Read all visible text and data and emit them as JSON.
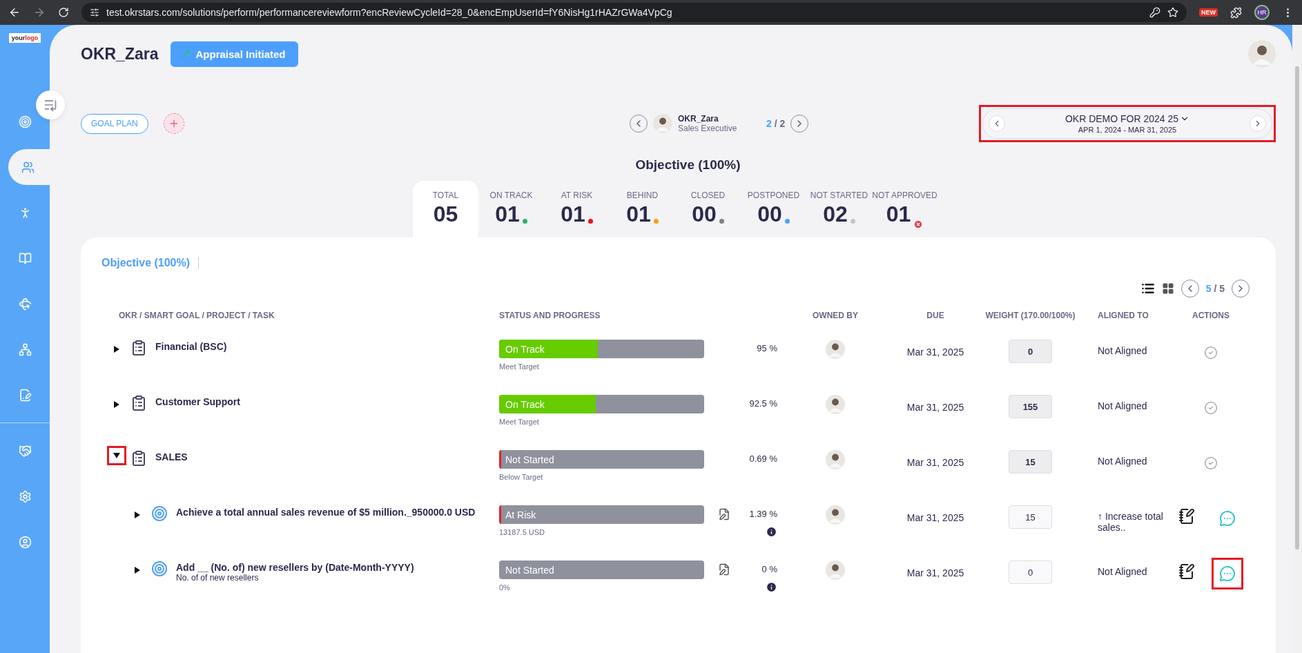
{
  "browser": {
    "url": "test.okrstars.com/solutions/perform/performancereviewform?encReviewCycleId=28_0&encEmpUserId=fY6NisHg1rHAZrGWa4VpCg",
    "badge": "NEW",
    "profile": "HR"
  },
  "logo": {
    "text": "your",
    "accent": "logo"
  },
  "sidebar": {
    "groups": [
      [
        {
          "selected": false
        },
        {
          "selected": true
        },
        {
          "selected": false
        },
        {
          "selected": false
        },
        {
          "selected": false
        },
        {
          "selected": false
        },
        {
          "selected": false
        }
      ],
      [
        {
          "selected": false
        },
        {
          "selected": false
        },
        {
          "selected": false
        }
      ]
    ]
  },
  "header": {
    "title": "OKR_Zara",
    "status_button": "Appraisal Initiated"
  },
  "goal_plan": {
    "button": "GOAL PLAN"
  },
  "employee": {
    "name": "OKR_Zara",
    "role": "Sales Executive",
    "current": "2",
    "separator": "/",
    "total": "2"
  },
  "cycle": {
    "title": "OKR DEMO FOR 2024 25",
    "dates": "APR 1, 2024 - MAR 31, 2025",
    "highlighted": true
  },
  "summary": {
    "title": "Objective (100%)",
    "stats": [
      {
        "label": "TOTAL",
        "value": "05",
        "kind": "plain",
        "selected": true
      },
      {
        "label": "ON TRACK",
        "value": "01",
        "kind": "dot",
        "color": "#1fb86a",
        "selected": false
      },
      {
        "label": "AT RISK",
        "value": "01",
        "kind": "dot",
        "color": "#ee1111",
        "selected": false
      },
      {
        "label": "BEHIND",
        "value": "01",
        "kind": "dot",
        "color": "#f5a300",
        "selected": false
      },
      {
        "label": "CLOSED",
        "value": "00",
        "kind": "dot",
        "color": "#7f7f86",
        "selected": false
      },
      {
        "label": "POSTPONED",
        "value": "00",
        "kind": "dot",
        "color": "#4da3ff",
        "selected": false
      },
      {
        "label": "NOT STARTED",
        "value": "02",
        "kind": "dot",
        "color": "#c4c4cc",
        "selected": false
      },
      {
        "label": "NOT APPROVED",
        "value": "01",
        "kind": "cross",
        "color": "#e0424f",
        "selected": false
      }
    ]
  },
  "card": {
    "tabs": [
      {
        "label": "Objective (100%)",
        "selected": true
      }
    ],
    "pager": {
      "current": "5",
      "separator": "/",
      "total": "5"
    },
    "columns": [
      "OKR / SMART GOAL / PROJECT / TASK",
      "STATUS AND PROGRESS",
      "OWNED BY",
      "DUE",
      "WEIGHT (170.00/100%)",
      "ALIGNED TO",
      "ACTIONS"
    ],
    "rows": [
      {
        "kind": "objective",
        "title": "Financial (BSC)",
        "expanded": false,
        "toggle_highlighted": false,
        "status": "On Track",
        "level": 0.48,
        "color": "#66cc00",
        "note": "Meet Target",
        "percent": "95 %",
        "due": "Mar 31, 2025",
        "weight": "0",
        "aligned": "Not Aligned",
        "action_highlighted": false
      },
      {
        "kind": "objective",
        "title": "Customer Support",
        "expanded": false,
        "toggle_highlighted": false,
        "status": "On Track",
        "level": 0.47,
        "color": "#66cc00",
        "note": "Meet Target",
        "percent": "92.5 %",
        "due": "Mar 31, 2025",
        "weight": "155",
        "aligned": "Not Aligned",
        "action_highlighted": false
      },
      {
        "kind": "objective",
        "title": "SALES",
        "expanded": true,
        "toggle_highlighted": true,
        "status": "Not Started",
        "level": 0.01,
        "color": "#e8202a",
        "note": "Below Target",
        "percent": "0.69 %",
        "due": "Mar 31, 2025",
        "weight": "15",
        "aligned": "Not Aligned",
        "action_highlighted": false,
        "children": [
          {
            "kind": "key_result",
            "title": "Achieve a total annual sales revenue of $5 million._950000.0 USD",
            "expanded": false,
            "toggle_highlighted": false,
            "status": "At Risk",
            "level": 0.01,
            "color": "#e8202a",
            "note": "13187.5 USD",
            "percent": "1.39 %",
            "due": "Mar 31, 2025",
            "weight": "15",
            "aligned": "↑ Increase total sales..",
            "action_highlighted": false
          },
          {
            "kind": "key_result",
            "title": "Add __ (No. of) new resellers by (Date-Month-YYYY)",
            "subtitle": "No. of of new resellers",
            "expanded": false,
            "toggle_highlighted": false,
            "status": "Not Started",
            "level": 0,
            "note": "0%",
            "percent": "0 %",
            "due": "Mar 31, 2025",
            "weight": "0",
            "aligned": "Not Aligned",
            "action_highlighted": true
          }
        ]
      }
    ]
  }
}
